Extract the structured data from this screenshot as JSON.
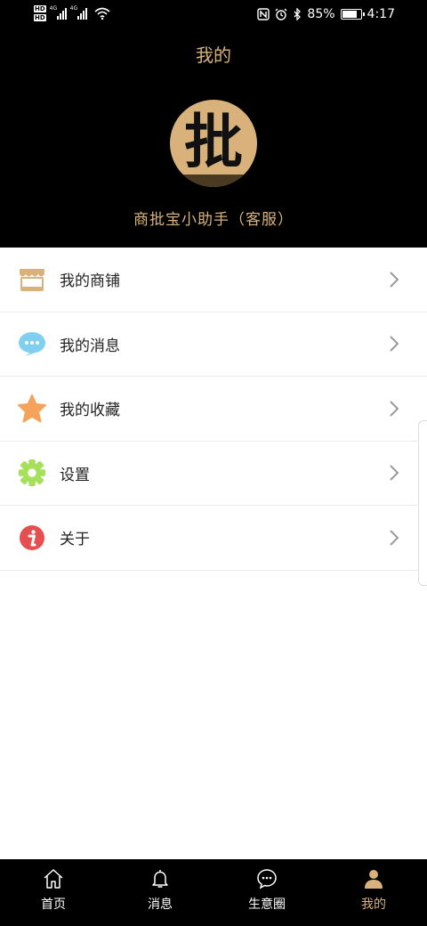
{
  "status_bar": {
    "hd_top": "HD",
    "hd_bottom": "HD",
    "network_1": "4G",
    "network_2": "4G",
    "battery_percent": "85%",
    "battery_level": 0.85,
    "time": "4:17"
  },
  "header": {
    "title": "我的",
    "avatar_glyph": "批",
    "user_name": "商批宝小助手（客服）"
  },
  "menu": {
    "items": [
      {
        "label": "我的商铺",
        "icon": "shop-icon",
        "color": "#d8b27a"
      },
      {
        "label": "我的消息",
        "icon": "chat-bubble-icon",
        "color": "#7fd0f0"
      },
      {
        "label": "我的收藏",
        "icon": "star-icon",
        "color": "#f5a25a"
      },
      {
        "label": "设置",
        "icon": "gear-icon",
        "color": "#a4e05a"
      },
      {
        "label": "关于",
        "icon": "info-icon",
        "color": "#e64f4f"
      }
    ]
  },
  "bottom_nav": {
    "items": [
      {
        "label": "首页",
        "icon": "home-icon"
      },
      {
        "label": "消息",
        "icon": "bell-icon"
      },
      {
        "label": "生意圈",
        "icon": "chat-circle-icon"
      },
      {
        "label": "我的",
        "icon": "person-icon"
      }
    ],
    "active_index": 3
  },
  "colors": {
    "accent": "#d8b27a",
    "header_bg": "#000000",
    "divider": "#ececec"
  }
}
